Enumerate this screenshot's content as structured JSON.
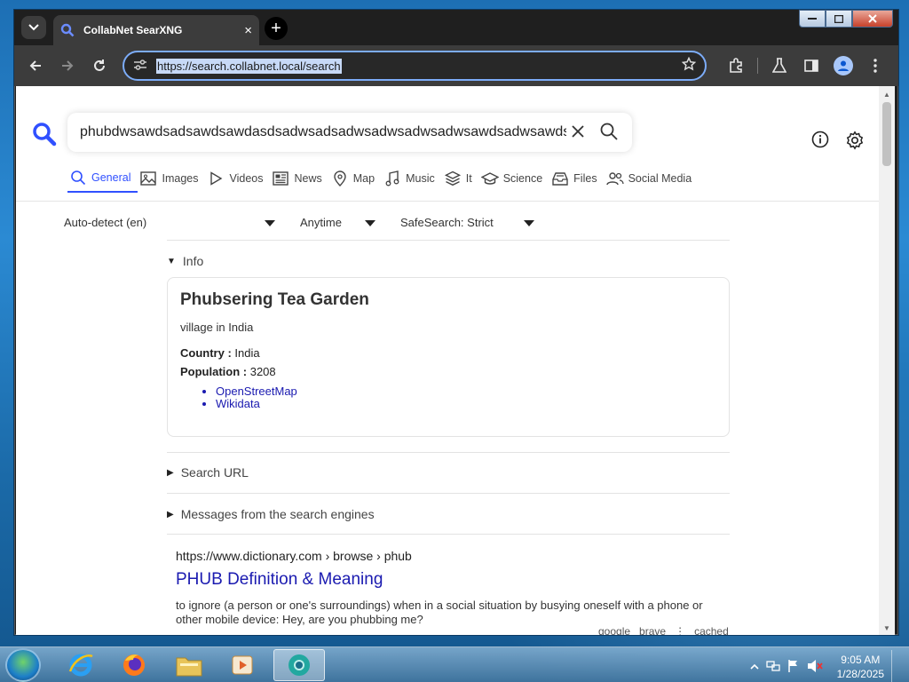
{
  "browser": {
    "tab_title": "CollabNet SearXNG",
    "tab_close": "×",
    "new_tab": "+",
    "url": "https://search.collabnet.local/search"
  },
  "search": {
    "query": "phubdwsawdsadsawdsawdasdsadwsadsadwsadwsadwsadwsawdsadwsawdsadwsawdsadwsa"
  },
  "categories": [
    {
      "label": "General",
      "icon": "search-icon",
      "active": true
    },
    {
      "label": "Images",
      "icon": "image-icon"
    },
    {
      "label": "Videos",
      "icon": "play-icon"
    },
    {
      "label": "News",
      "icon": "newspaper-icon"
    },
    {
      "label": "Map",
      "icon": "map-pin-icon"
    },
    {
      "label": "Music",
      "icon": "music-note-icon"
    },
    {
      "label": "It",
      "icon": "layers-icon"
    },
    {
      "label": "Science",
      "icon": "graduation-cap-icon"
    },
    {
      "label": "Files",
      "icon": "inbox-icon"
    },
    {
      "label": "Social Media",
      "icon": "users-icon"
    }
  ],
  "filters": {
    "language": "Auto-detect (en)",
    "time": "Anytime",
    "safesearch": "SafeSearch: Strict"
  },
  "info": {
    "section_label": "Info",
    "title": "Phubsering Tea Garden",
    "description": "village in India",
    "attributes": [
      {
        "label": "Country :",
        "value": " India"
      },
      {
        "label": "Population :",
        "value": " 3208"
      }
    ],
    "links": [
      "OpenStreetMap",
      "Wikidata"
    ]
  },
  "sections": {
    "search_url": "Search URL",
    "messages": "Messages from the search engines"
  },
  "result": {
    "url_host": "https://www.dictionary.com",
    "url_path": " › browse › phub",
    "title": "PHUB Definition & Meaning",
    "description": "to ignore (a person or one's surroundings) when in a social situation by busying oneself with a phone or other mobile device: Hey, are you phubbing me?",
    "engines": [
      "google",
      "brave"
    ],
    "cached": "cached",
    "engines_sep": "⋮"
  },
  "taskbar": {
    "time": "9:05 AM",
    "date": "1/28/2025"
  },
  "colors": {
    "accent": "#3050ff",
    "link": "#1a1ab0",
    "toolbar": "#3c3c3c"
  }
}
